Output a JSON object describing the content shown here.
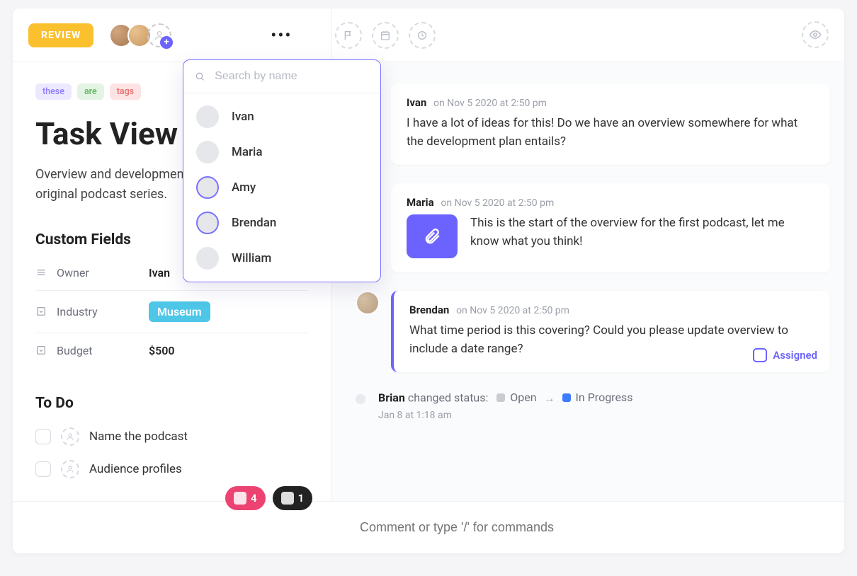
{
  "header": {
    "status_badge": "REVIEW"
  },
  "task": {
    "tags": [
      "these",
      "are",
      "tags"
    ],
    "title": "Task View",
    "description": "Overview and development plan for Hive's first original podcast series."
  },
  "custom_fields": {
    "heading": "Custom Fields",
    "rows": [
      {
        "icon": "list",
        "label": "Owner",
        "value": "Ivan",
        "type": "text"
      },
      {
        "icon": "dropdown",
        "label": "Industry",
        "value": "Museum",
        "type": "chip"
      },
      {
        "icon": "dropdown",
        "label": "Budget",
        "value": "$500",
        "type": "text"
      }
    ]
  },
  "todo": {
    "heading": "To Do",
    "items": [
      {
        "label": "Name the podcast"
      },
      {
        "label": "Audience profiles"
      }
    ]
  },
  "assignee_dropdown": {
    "search_placeholder": "Search by name",
    "people": [
      {
        "name": "Ivan",
        "avatar": "av-ivan",
        "selected": false
      },
      {
        "name": "Maria",
        "avatar": "av-maria",
        "selected": false
      },
      {
        "name": "Amy",
        "avatar": "av-amy",
        "selected": true
      },
      {
        "name": "Brendan",
        "avatar": "av-brendan",
        "selected": true
      },
      {
        "name": "William",
        "avatar": "av-william",
        "selected": false
      }
    ]
  },
  "comments": [
    {
      "author": "Ivan",
      "date": "on Nov 5 2020 at 2:50 pm",
      "body": "I have a lot of ideas for this! Do we have an overview somewhere for what the development plan entails?",
      "attachment": false,
      "assigned": false
    },
    {
      "author": "Maria",
      "date": "on Nov 5 2020 at 2:50 pm",
      "body": "This is the start of the overview for the first podcast, let me know what you think!",
      "attachment": true,
      "assigned": false
    },
    {
      "author": "Brendan",
      "date": "on Nov 5 2020 at 2:50 pm",
      "body": "What time period is this covering? Could you please update overview to include a date range?",
      "attachment": false,
      "assigned": true,
      "assigned_label": "Assigned"
    }
  ],
  "activity": {
    "actor": "Brian",
    "verb": "changed status:",
    "from": {
      "label": "Open",
      "color": "#c9cbd1"
    },
    "to": {
      "label": "In Progress",
      "color": "#3d7bff"
    },
    "timestamp": "Jan 8 at 1:18 am"
  },
  "composer": {
    "placeholder": "Comment or type '/' for commands",
    "chips": [
      {
        "label": "4",
        "kind": "pink"
      },
      {
        "label": "1",
        "kind": "dark"
      }
    ]
  },
  "colors": {
    "accent": "#6c63ff",
    "review": "#fbc02d",
    "chip_blue": "#4ec6e8"
  }
}
